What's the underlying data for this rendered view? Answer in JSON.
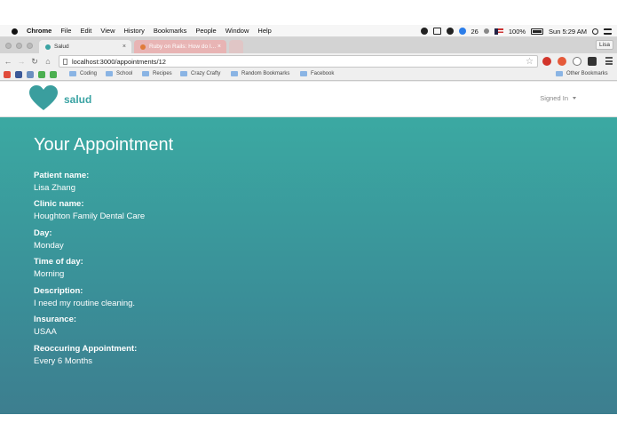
{
  "menubar": {
    "app": "Chrome",
    "items": [
      "File",
      "Edit",
      "View",
      "History",
      "Bookmarks",
      "People",
      "Window",
      "Help"
    ],
    "notification_count": "26",
    "battery": "100%",
    "clock": "Sun 5:29 AM"
  },
  "browser": {
    "tabs": [
      {
        "label": "Salud"
      },
      {
        "label": "Ruby on Rails: How do I..."
      }
    ],
    "profile": "Lisa",
    "url": "localhost:3000/appointments/12",
    "bookmarks": [
      "Coding",
      "School",
      "Recipes",
      "Crazy Crafty",
      "Random Bookmarks",
      "Facebook"
    ],
    "other_bookmarks": "Other Bookmarks"
  },
  "navbar": {
    "brand": "salud",
    "signed_in": "Signed In",
    "accent": "#3aa3a3"
  },
  "appointment": {
    "title": "Your Appointment",
    "fields": [
      {
        "label": "Patient name:",
        "value": "Lisa Zhang"
      },
      {
        "label": "Clinic name:",
        "value": "Houghton Family Dental Care"
      },
      {
        "label": "Day:",
        "value": "Monday"
      },
      {
        "label": "Time of day:",
        "value": "Morning"
      },
      {
        "label": "Description:",
        "value": "I need my routine cleaning."
      },
      {
        "label": "Insurance:",
        "value": "USAA"
      },
      {
        "label": "Reoccuring Appointment:",
        "value": "Every 6 Months"
      }
    ]
  }
}
